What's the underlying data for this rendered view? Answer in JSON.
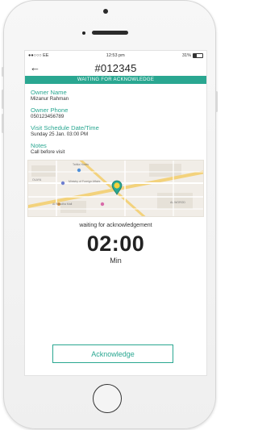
{
  "status_bar": {
    "carrier": "●●○○○ EE",
    "wifi_icon": "wifi-icon",
    "time": "12:53 pm",
    "battery_pct": "31%"
  },
  "header": {
    "back_icon": "back-arrow-icon",
    "order_id": "#012345"
  },
  "banner": {
    "text": "WAITING FOR ACKNOWLEDGE",
    "color": "#2aa791"
  },
  "details": {
    "owner_name_label": "Owner Name",
    "owner_name": "Mizanur Rahman",
    "owner_phone_label": "Owner Phone",
    "owner_phone": "050123456789",
    "visit_label": "Visit Schedule Date/Time",
    "visit_value": "Sunday  25  Jan.  03:00 PM",
    "notes_label": "Notes",
    "notes_value": "Call before visit"
  },
  "map": {
    "labels": [
      "Tahlia Hotels",
      "Ministry of Foreign Affairs",
      "Al Rawdha Mall",
      "AL WOROD",
      "OLAYA"
    ],
    "pin_icon": "location-pin-icon"
  },
  "countdown": {
    "caption": "waiting for acknowledgement",
    "time": "02:00",
    "unit": "Min"
  },
  "actions": {
    "acknowledge_label": "Acknowledge"
  }
}
